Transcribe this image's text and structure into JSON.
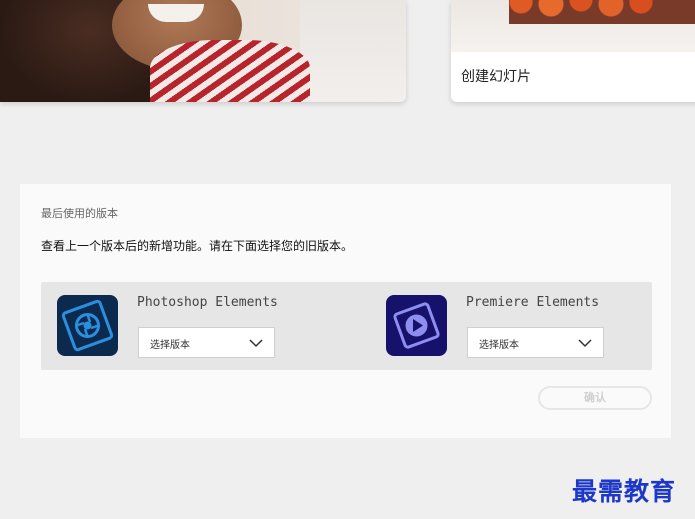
{
  "cards": {
    "slideshow_title": "创建幻灯片"
  },
  "last_version": {
    "heading": "最后使用的版本",
    "description": "查看上一个版本后的新增功能。请在下面选择您的旧版本。",
    "products": [
      {
        "name": "Photoshop Elements",
        "select_value": "选择版本",
        "icon": "photoshop-elements-icon",
        "icon_color": "#0c2a4d"
      },
      {
        "name": "Premiere Elements",
        "select_value": "选择版本",
        "icon": "premiere-elements-icon",
        "icon_color": "#16126b"
      }
    ],
    "confirm_label": "确认"
  },
  "watermark": "最需教育"
}
